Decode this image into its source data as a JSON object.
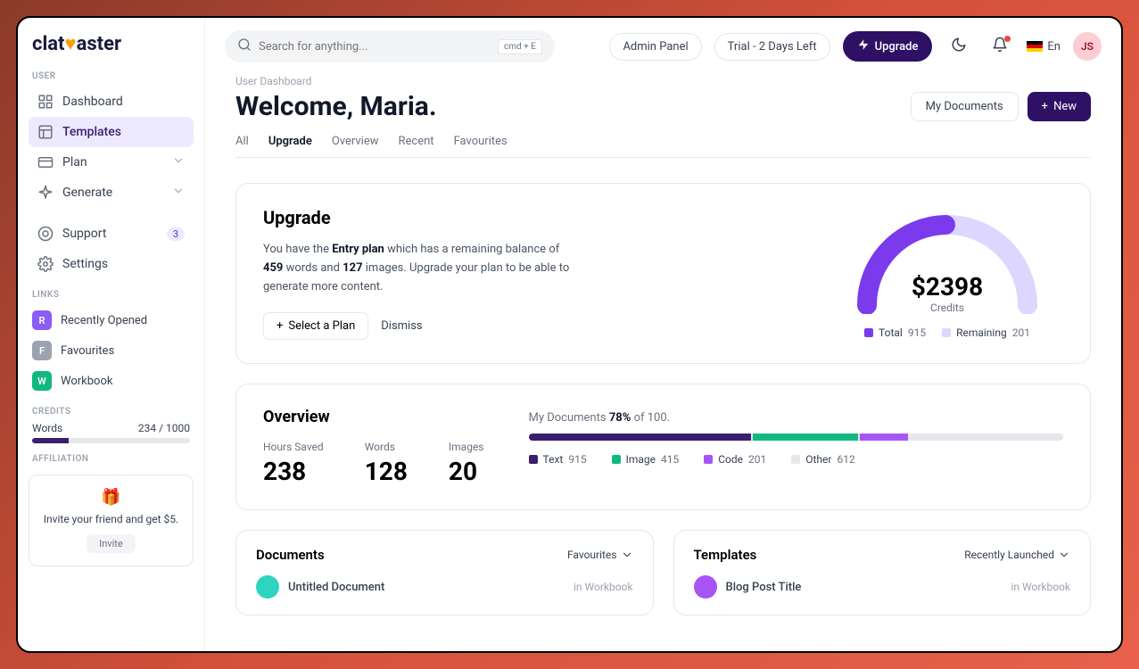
{
  "brand": {
    "part1": "clat",
    "part2": "aster"
  },
  "search": {
    "placeholder": "Search for anything...",
    "kbd": "cmd + E"
  },
  "topbar": {
    "admin_panel": "Admin Panel",
    "trial": "Trial - 2 Days Left",
    "upgrade": "Upgrade",
    "lang": "En",
    "avatar": "JS"
  },
  "sidebar": {
    "user_label": "USER",
    "items": [
      {
        "label": "Dashboard"
      },
      {
        "label": "Templates"
      },
      {
        "label": "Plan"
      },
      {
        "label": "Generate"
      }
    ],
    "support": "Support",
    "support_badge": "3",
    "settings": "Settings",
    "links_label": "LINKS",
    "links": [
      {
        "k": "R",
        "label": "Recently Opened",
        "color": "#8b5cf6"
      },
      {
        "k": "F",
        "label": "Favourites",
        "color": "#9ca3af"
      },
      {
        "k": "W",
        "label": "Workbook",
        "color": "#10b981"
      }
    ],
    "credits_label": "CREDITS",
    "credits_name": "Words",
    "credits_value": "234 / 1000",
    "credits_pct": 23,
    "affiliation_label": "AFFILIATION",
    "invite_text": "Invite your friend and get $5.",
    "invite_btn": "Invite"
  },
  "page": {
    "breadcrumb": "User Dashboard",
    "title": "Welcome, Maria.",
    "my_documents": "My Documents",
    "new_btn": "New",
    "tabs": [
      "All",
      "Upgrade",
      "Overview",
      "Recent",
      "Favourites"
    ]
  },
  "upgrade": {
    "title": "Upgrade",
    "text_1": "You have the ",
    "plan_name": "Entry plan",
    "text_2": " which has a remaining balance of ",
    "words": "459",
    "text_3": " words and ",
    "images": "127",
    "text_4": " images. Upgrade your plan to be able to generate more content.",
    "select_plan": "Select a Plan",
    "dismiss": "Dismiss",
    "gauge_value": "$2398",
    "gauge_label": "Credits",
    "legend_total": "Total",
    "legend_total_v": "915",
    "legend_remaining": "Remaining",
    "legend_remaining_v": "201",
    "color_total": "#7c3aed",
    "color_remaining": "#ddd6fe"
  },
  "overview": {
    "title": "Overview",
    "stats": [
      {
        "label": "Hours Saved",
        "value": "238"
      },
      {
        "label": "Words",
        "value": "128"
      },
      {
        "label": "Images",
        "value": "20"
      }
    ],
    "line_1": "My Documents ",
    "pct": "78%",
    "line_2": " of 100.",
    "segments": [
      {
        "name": "Text",
        "value": "915",
        "color": "#3b1e6e",
        "pct": 42
      },
      {
        "name": "Image",
        "value": "415",
        "color": "#10b981",
        "pct": 20
      },
      {
        "name": "Code",
        "value": "201",
        "color": "#a855f7",
        "pct": 9
      },
      {
        "name": "Other",
        "value": "612",
        "color": "#e5e7eb",
        "pct": 29
      }
    ]
  },
  "bottom": {
    "documents": {
      "title": "Documents",
      "filter": "Favourites",
      "item_title": "Untitled Document",
      "item_meta": "in Workbook",
      "item_color": "#2dd4bf"
    },
    "templates": {
      "title": "Templates",
      "filter": "Recently Launched",
      "item_title": "Blog Post Title",
      "item_meta": "in Workbook",
      "item_color": "#a855f7"
    }
  }
}
